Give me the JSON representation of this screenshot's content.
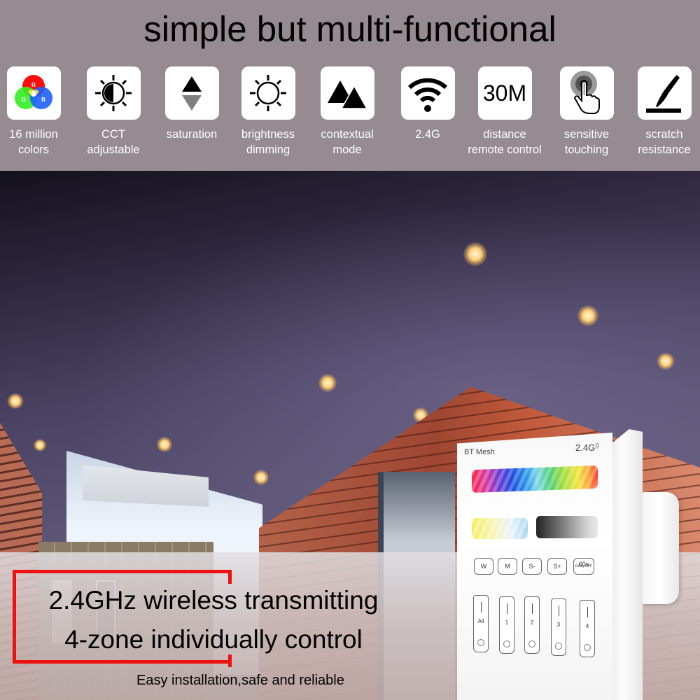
{
  "header": {
    "title": "simple but multi-functional",
    "background_color": "#968b90",
    "features": [
      {
        "icon": "rgb-circles-icon",
        "line1": "16 million",
        "line2": "colors",
        "rgb_letters": [
          "R",
          "G",
          "B"
        ]
      },
      {
        "icon": "half-sun-icon",
        "line1": "CCT",
        "line2": "adjustable"
      },
      {
        "icon": "up-down-triangles-icon",
        "line1": "saturation",
        "line2": ""
      },
      {
        "icon": "sun-icon",
        "line1": "brightness",
        "line2": "dimming"
      },
      {
        "icon": "mountains-icon",
        "line1": "contextual",
        "line2": "mode"
      },
      {
        "icon": "wifi-icon",
        "line1": "2.4G",
        "line2": ""
      },
      {
        "icon": "distance-text-icon",
        "tile_text": "30M",
        "line1": "distance",
        "line2": "remote control"
      },
      {
        "icon": "touch-finger-icon",
        "line1": "sensitive",
        "line2": "touching"
      },
      {
        "icon": "knife-scratch-icon",
        "line1": "scratch",
        "line2": "resistance"
      }
    ]
  },
  "product": {
    "brand": "BT Mesh",
    "frequency": "2.4G",
    "function_buttons": [
      {
        "label": "W"
      },
      {
        "label": "M"
      },
      {
        "label": "S-"
      },
      {
        "label": "S+"
      },
      {
        "label": "60s",
        "sub": "Delay OFF"
      }
    ],
    "zones": [
      {
        "label": "All"
      },
      {
        "label": "1"
      },
      {
        "label": "2"
      },
      {
        "label": "3"
      },
      {
        "label": "4"
      }
    ]
  },
  "overlay": {
    "headline_1": "2.4GHz wireless transmitting",
    "headline_2": "4-zone individually control",
    "tagline": "Easy installation,safe and reliable",
    "frame_color": "#ee1111"
  }
}
